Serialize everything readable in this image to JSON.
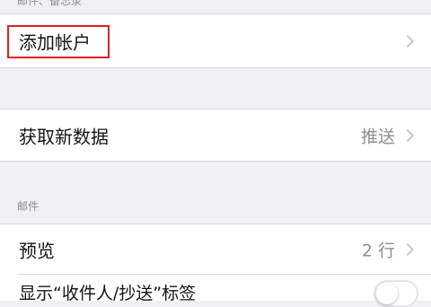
{
  "top_section": {
    "header": "邮件、备忘录",
    "add_account_label": "添加帐户"
  },
  "fetch_row": {
    "label": "获取新数据",
    "value": "推送"
  },
  "mail_section": {
    "header": "邮件",
    "preview_label": "预览",
    "preview_value": "2 行",
    "next_row_label": "显示“收件人/抄送”标签"
  },
  "colors": {
    "highlight": "#e02020",
    "background": "#efeff4",
    "secondary_text": "#8e8e93",
    "chevron": "#c7c7cc"
  },
  "icons": [
    "chevron-right-icon",
    "chevron-right-icon",
    "chevron-right-icon"
  ]
}
